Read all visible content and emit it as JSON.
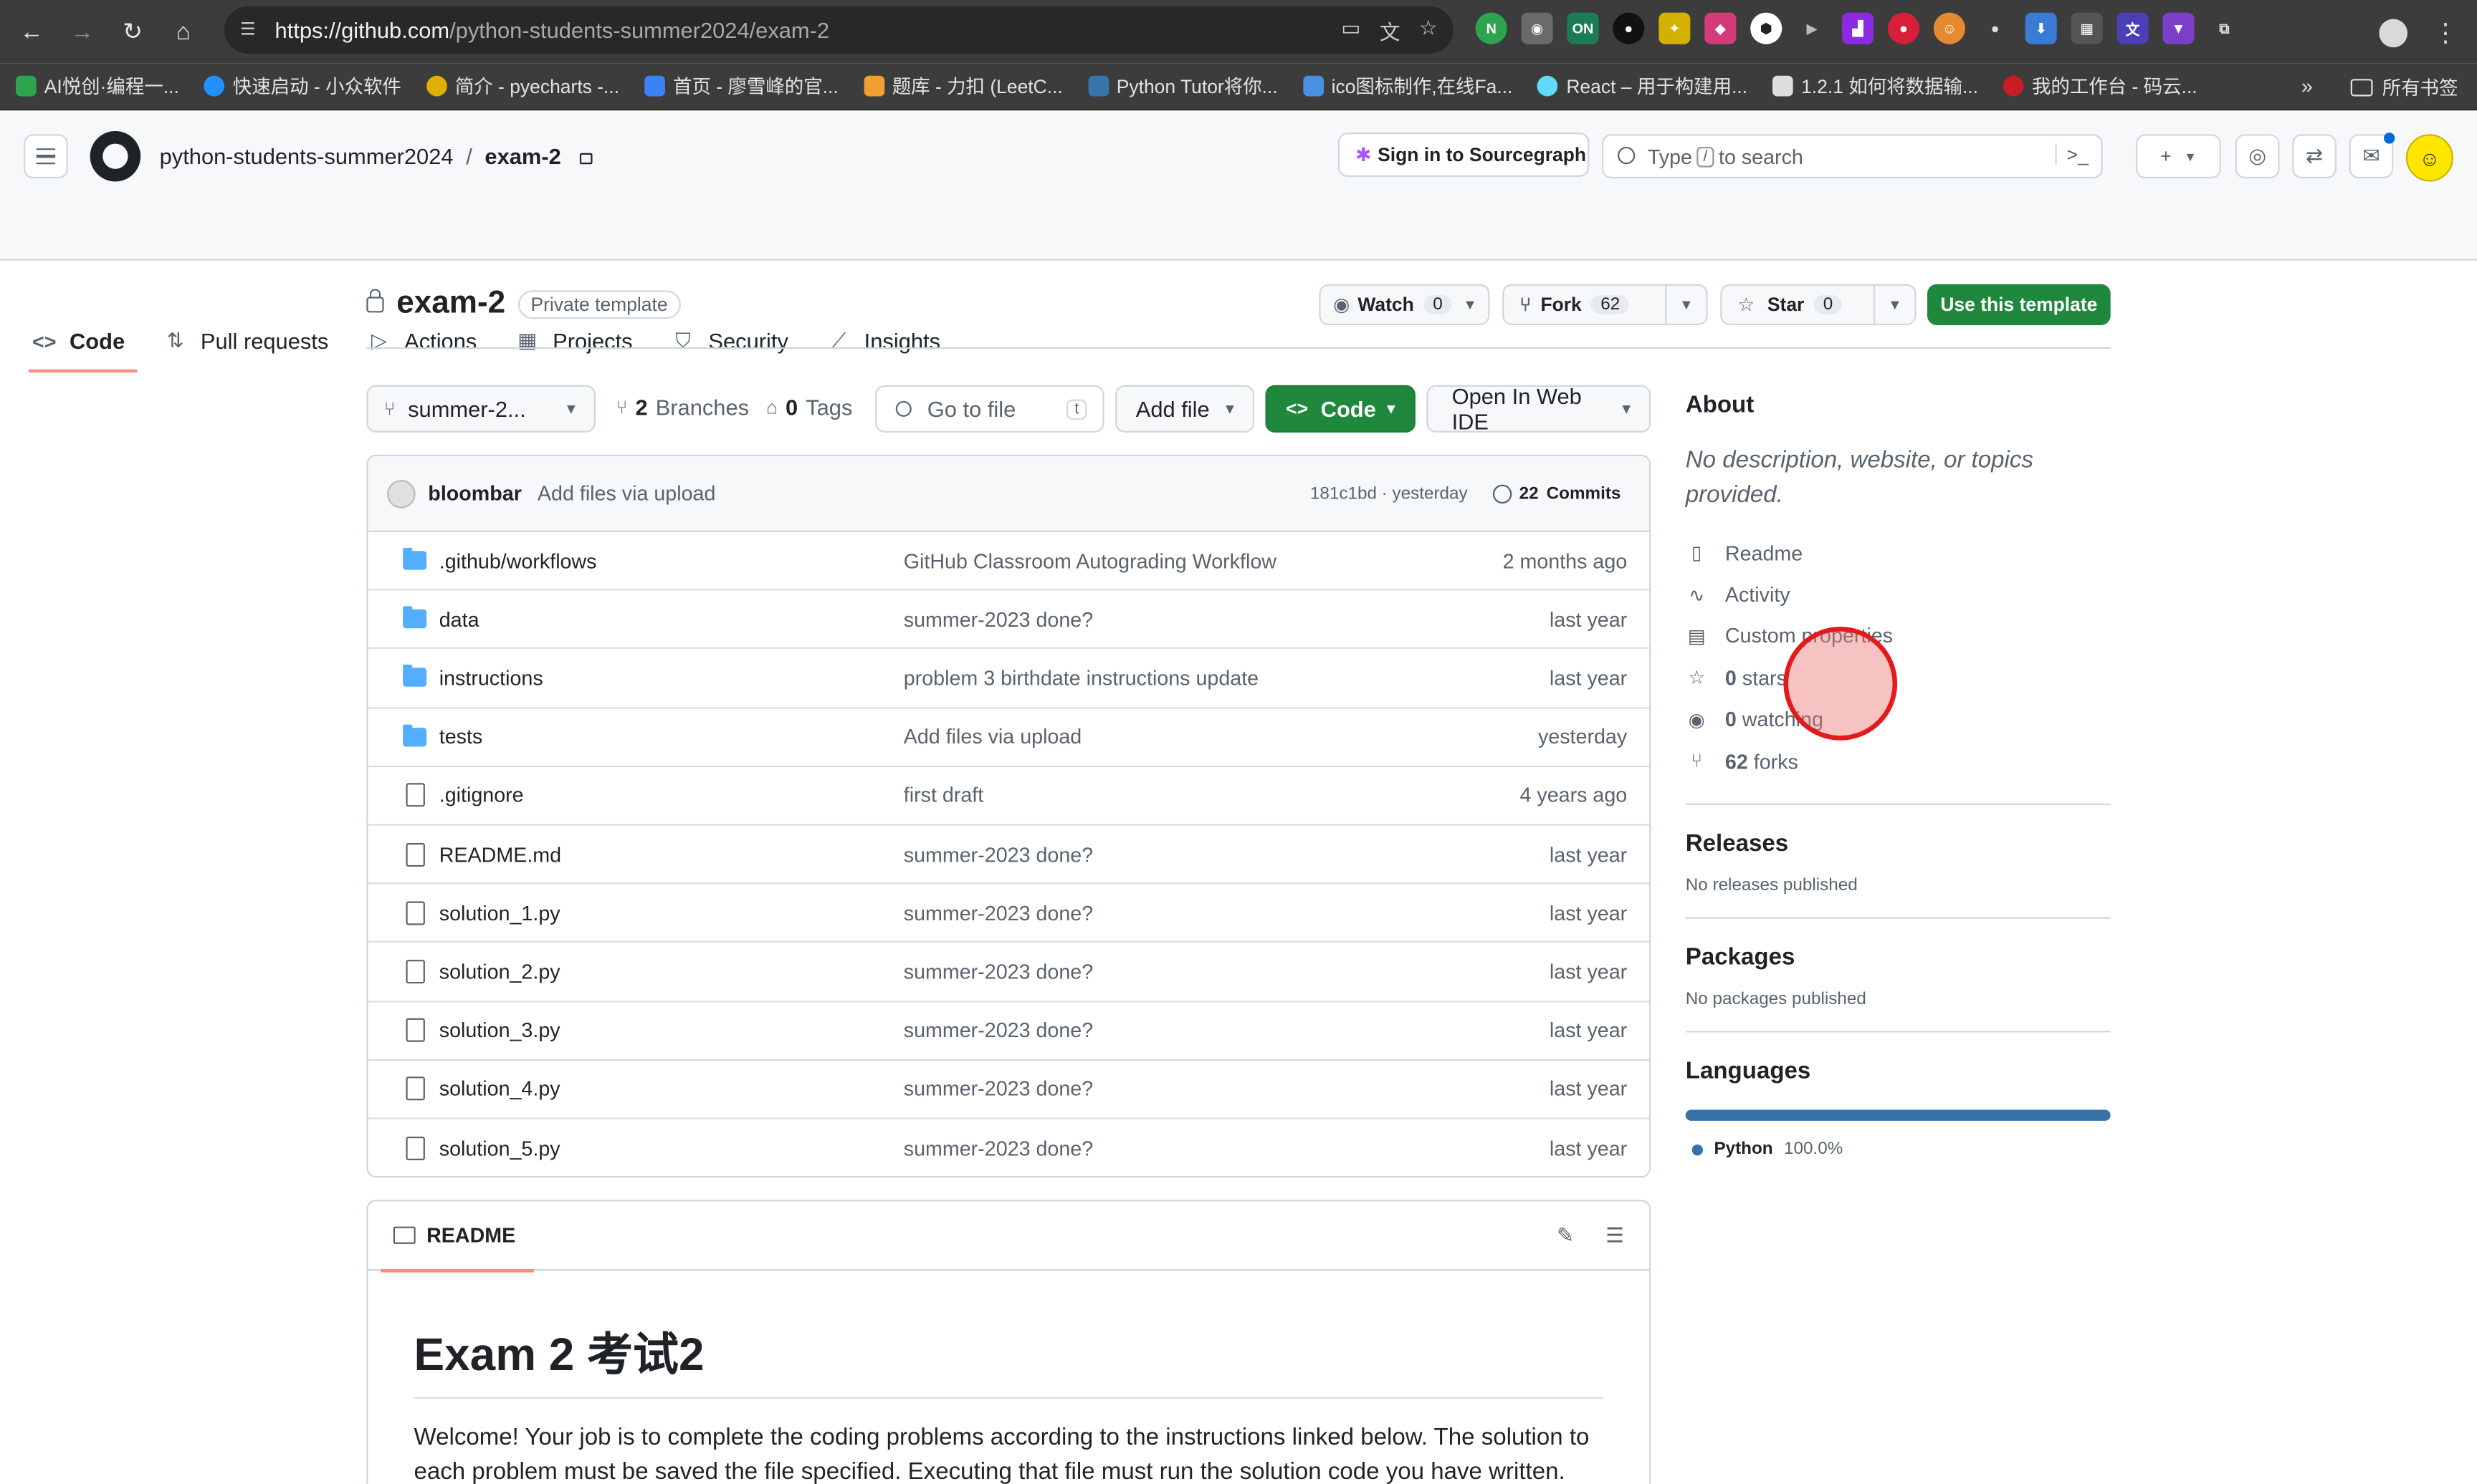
{
  "browser": {
    "url_host": "https://github.com",
    "url_path": "/python-students-summer2024/exam-2",
    "bookmarks": [
      {
        "label": "AI悦创·编程一...",
        "color": "#2da44e"
      },
      {
        "label": "快速启动 - 小众软件",
        "color": "#1e90ff"
      },
      {
        "label": "简介 - pyecharts -...",
        "color": "#e0b000"
      },
      {
        "label": "首页 - 廖雪峰的官...",
        "color": "#3b82f6"
      },
      {
        "label": "题库 - 力扣 (LeetC...",
        "color": "#f0a030"
      },
      {
        "label": "Python Tutor将你...",
        "color": "#3776ab"
      },
      {
        "label": "ico图标制作,在线Fa...",
        "color": "#4a90e2"
      },
      {
        "label": "React – 用于构建用...",
        "color": "#61dafb"
      },
      {
        "label": "1.2.1 如何将数据输...",
        "color": "#555555"
      },
      {
        "label": "我的工作台 - 码云...",
        "color": "#c71d23"
      }
    ],
    "bookmarks_more": "»",
    "all_bookmarks": "所有书签"
  },
  "header": {
    "org": "python-students-summer2024",
    "separator": "/",
    "repo": "exam-2",
    "sourcegraph_label": "Sign in to Sourcegraph",
    "search_prefix": "Type",
    "search_key": "/",
    "search_suffix": "to search"
  },
  "repo_nav": [
    {
      "label": "Code",
      "icon": "code-icon"
    },
    {
      "label": "Pull requests",
      "icon": "pull-request-icon"
    },
    {
      "label": "Actions",
      "icon": "play-icon"
    },
    {
      "label": "Projects",
      "icon": "table-icon"
    },
    {
      "label": "Security",
      "icon": "shield-icon"
    },
    {
      "label": "Insights",
      "icon": "graph-icon"
    }
  ],
  "repo": {
    "name": "exam-2",
    "badge": "Private template",
    "watch_label": "Watch",
    "watch_count": "0",
    "fork_label": "Fork",
    "fork_count": "62",
    "star_label": "Star",
    "star_count": "0",
    "use_template_label": "Use this template"
  },
  "controls": {
    "branch": "summer-2...",
    "branches_count": "2",
    "branches_label": "Branches",
    "tags_count": "0",
    "tags_label": "Tags",
    "goto_placeholder": "Go to file",
    "goto_key": "t",
    "add_file": "Add file",
    "code": "Code",
    "web_ide": "Open In Web IDE"
  },
  "latest_commit": {
    "author": "bloombar",
    "message": "Add files via upload",
    "hash_time": "181c1bd · yesterday",
    "commits_count": "22",
    "commits_label": "Commits"
  },
  "files": [
    {
      "name": ".github/workflows",
      "type": "folder",
      "message": "GitHub Classroom Autograding Workflow",
      "date": "2 months ago"
    },
    {
      "name": "data",
      "type": "folder",
      "message": "summer-2023 done?",
      "date": "last year"
    },
    {
      "name": "instructions",
      "type": "folder",
      "message": "problem 3 birthdate instructions update",
      "date": "last year"
    },
    {
      "name": "tests",
      "type": "folder",
      "message": "Add files via upload",
      "date": "yesterday"
    },
    {
      "name": ".gitignore",
      "type": "file",
      "message": "first draft",
      "date": "4 years ago"
    },
    {
      "name": "README.md",
      "type": "file",
      "message": "summer-2023 done?",
      "date": "last year"
    },
    {
      "name": "solution_1.py",
      "type": "file",
      "message": "summer-2023 done?",
      "date": "last year"
    },
    {
      "name": "solution_2.py",
      "type": "file",
      "message": "summer-2023 done?",
      "date": "last year"
    },
    {
      "name": "solution_3.py",
      "type": "file",
      "message": "summer-2023 done?",
      "date": "last year"
    },
    {
      "name": "solution_4.py",
      "type": "file",
      "message": "summer-2023 done?",
      "date": "last year"
    },
    {
      "name": "solution_5.py",
      "type": "file",
      "message": "summer-2023 done?",
      "date": "last year"
    }
  ],
  "readme": {
    "tab_label": "README",
    "title": "Exam 2 考试2",
    "body": "Welcome! Your job is to complete the coding problems according to the instructions linked below. The solution to each problem must be saved the file specified. Executing that file must run the solution code you have written."
  },
  "about": {
    "heading": "About",
    "description": "No description, website, or topics provided.",
    "items": [
      {
        "icon": "book-icon",
        "label": "Readme"
      },
      {
        "icon": "pulse-icon",
        "label": "Activity"
      },
      {
        "icon": "note-icon",
        "label": "Custom properties"
      },
      {
        "icon": "star-icon",
        "label": "stars",
        "count": "0"
      },
      {
        "icon": "eye-icon",
        "label": "watching",
        "count": "0"
      },
      {
        "icon": "fork-icon",
        "label": "forks",
        "count": "62"
      }
    ]
  },
  "releases": {
    "heading": "Releases",
    "text": "No releases published"
  },
  "packages": {
    "heading": "Packages",
    "text": "No packages published"
  },
  "languages": {
    "heading": "Languages",
    "name": "Python",
    "percent": "100.0%",
    "color": "#3572A5"
  }
}
